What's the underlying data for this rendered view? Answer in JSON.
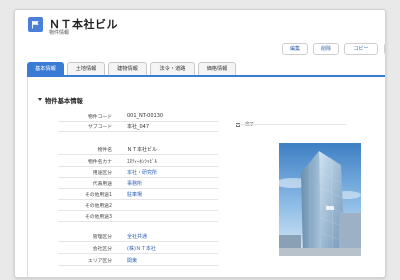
{
  "header": {
    "title": "ＮＴ本社ビル",
    "subtitle": "物件情報"
  },
  "actions": {
    "edit_label": "編集",
    "delete_label": "削除",
    "copy_label": "コピー"
  },
  "tabs": [
    {
      "label": "基本情報",
      "active": true
    },
    {
      "label": "土地情報",
      "active": false
    },
    {
      "label": "建物情報",
      "active": false
    },
    {
      "label": "法令・道路",
      "active": false
    },
    {
      "label": "価格情報",
      "active": false
    }
  ],
  "section": {
    "title": "物件基本情報"
  },
  "fields": [
    {
      "label": "物件コード",
      "value": "001_NT-00130",
      "link": false
    },
    {
      "label": "サブコード",
      "value": "本社_047",
      "link": false
    },
    {
      "label": "物件名",
      "value": "ＮＴ本社ビル",
      "link": false
    },
    {
      "label": "物件名カナ",
      "value": "ｴﾇﾃｨｰﾎﾝｼｬﾋﾞﾙ",
      "link": false
    },
    {
      "label": "用途区分",
      "value": "本社・研究所",
      "link": true
    },
    {
      "label": "代表用途",
      "value": "事務所",
      "link": true
    },
    {
      "label": "その他用途1",
      "value": "駐車場",
      "link": true
    },
    {
      "label": "その他用途2",
      "value": "",
      "link": false
    },
    {
      "label": "その他用途3",
      "value": "",
      "link": false
    },
    {
      "label": "管理区分",
      "value": "全社共通",
      "link": true
    },
    {
      "label": "会社区分",
      "value": "(株)ＮＴ本社",
      "link": true
    },
    {
      "label": "エリア区分",
      "value": "関東",
      "link": true
    }
  ],
  "completed": {
    "label": "完了",
    "checked": false
  },
  "colors": {
    "accent": "#3a7bd5",
    "link": "#2a5fb0",
    "icon": "#4b80d9"
  }
}
